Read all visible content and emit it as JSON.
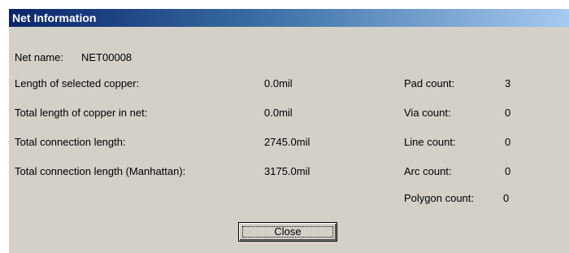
{
  "window": {
    "title": "Net Information"
  },
  "net": {
    "name_label": "Net name:",
    "name_value": "NET00008"
  },
  "stats": [
    {
      "label": "Length of selected copper:",
      "value": "0.0mil"
    },
    {
      "label": "Total length of copper in net:",
      "value": "0.0mil"
    },
    {
      "label": "Total connection length:",
      "value": "2745.0mil"
    },
    {
      "label": "Total connection length (Manhattan):",
      "value": "3175.0mil"
    }
  ],
  "counts": [
    {
      "label": "Pad count:",
      "value": "3"
    },
    {
      "label": "Via count:",
      "value": "0"
    },
    {
      "label": "Line count:",
      "value": "0"
    },
    {
      "label": "Arc count:",
      "value": "0"
    },
    {
      "label": "Polygon count:",
      "value": "0"
    }
  ],
  "buttons": {
    "close_label": "Close"
  },
  "colors": {
    "titlebar_start": "#0a246a",
    "titlebar_end": "#a6caf0",
    "dialog_face": "#d4d0c8"
  }
}
